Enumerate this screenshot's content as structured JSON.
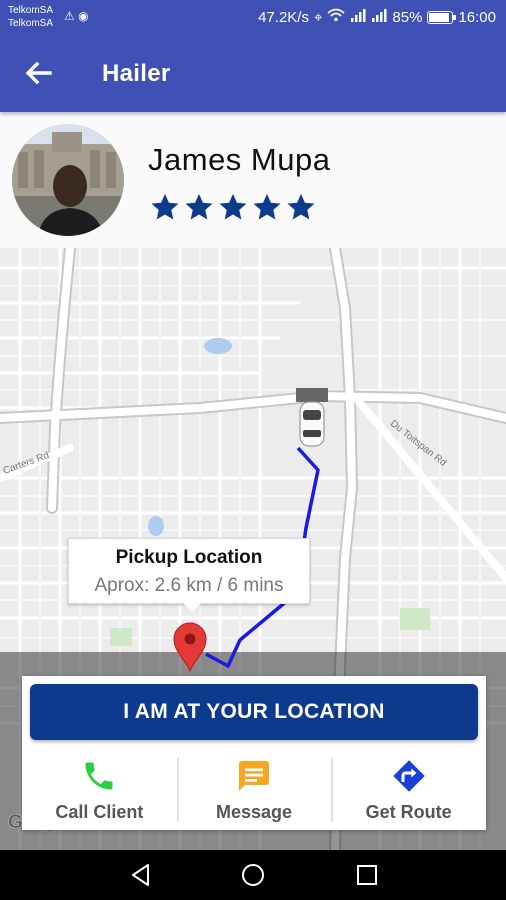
{
  "status_bar": {
    "carrier_1": "TelkomSA",
    "carrier_2": "TelkomSA",
    "net_speed": "47.2K/s",
    "battery": "85%",
    "time": "16:00"
  },
  "app_bar": {
    "title": "Hailer",
    "back_icon": "arrow-back-icon"
  },
  "driver": {
    "name": "James Mupa",
    "rating": 5,
    "rating_max": 5
  },
  "map": {
    "road_labels": [
      "Du Toitspan Rd",
      "Carters Rd"
    ],
    "callout_title": "Pickup Location",
    "callout_subtitle": "Aprox: 2.6 km / 6 mins",
    "attribution": "Google",
    "route_color": "#1A1AE6",
    "pin_color": "#E53935"
  },
  "panel": {
    "primary_button": "I AM AT YOUR LOCATION",
    "actions": [
      {
        "label": "Call Client",
        "icon": "phone-icon",
        "color": "#2ECC40"
      },
      {
        "label": "Message",
        "icon": "message-icon",
        "color": "#F5A623"
      },
      {
        "label": "Get Route",
        "icon": "directions-icon",
        "color": "#1A3FD6"
      }
    ]
  },
  "colors": {
    "primary": "#3F51B5",
    "button": "#0D3A8C",
    "star": "#0D3A8C"
  }
}
